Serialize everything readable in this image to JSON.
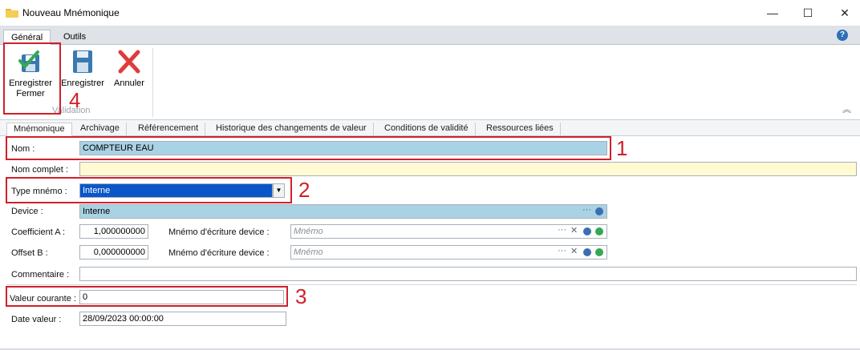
{
  "window": {
    "title": "Nouveau Mnémonique",
    "minimize": "—",
    "maximize": "☐",
    "close": "✕"
  },
  "ribbon": {
    "tabs": [
      "Général",
      "Outils"
    ],
    "help_icon": "?",
    "buttons": {
      "save_close": "Enregistrer\nFermer",
      "save": "Enregistrer",
      "cancel": "Annuler"
    },
    "group_label": "Validation",
    "collapse_icon": "︽"
  },
  "tabs": [
    "Mnémonique",
    "Archivage",
    "Référencement",
    "Historique des changements de valeur",
    "Conditions de validité",
    "Ressources liées"
  ],
  "form": {
    "nom_label": "Nom :",
    "nom_value": "COMPTEUR EAU",
    "nom_complet_label": "Nom complet :",
    "nom_complet_value": "",
    "type_label": "Type mnémo :",
    "type_value": "Interne",
    "device_label": "Device :",
    "device_value": "Interne",
    "coef_label": "Coefficient A :",
    "coef_value": "1,000000000",
    "offset_label": "Offset B :",
    "offset_value": "0,000000000",
    "mnemo_write_label": "Mnémo d'écriture device :",
    "mnemo_placeholder": "Mnémo",
    "commentaire_label": "Commentaire :",
    "commentaire_value": "",
    "valeur_label": "Valeur courante :",
    "valeur_value": "0",
    "date_label": "Date valeur :",
    "date_value": "28/09/2023 00:00:00"
  },
  "annotations": [
    "1",
    "2",
    "3",
    "4"
  ],
  "colors": {
    "annotation_red": "#d0202a",
    "field_blue": "#a9d2e4",
    "field_yellow": "#fffad2",
    "selection_blue": "#0a56c8"
  }
}
